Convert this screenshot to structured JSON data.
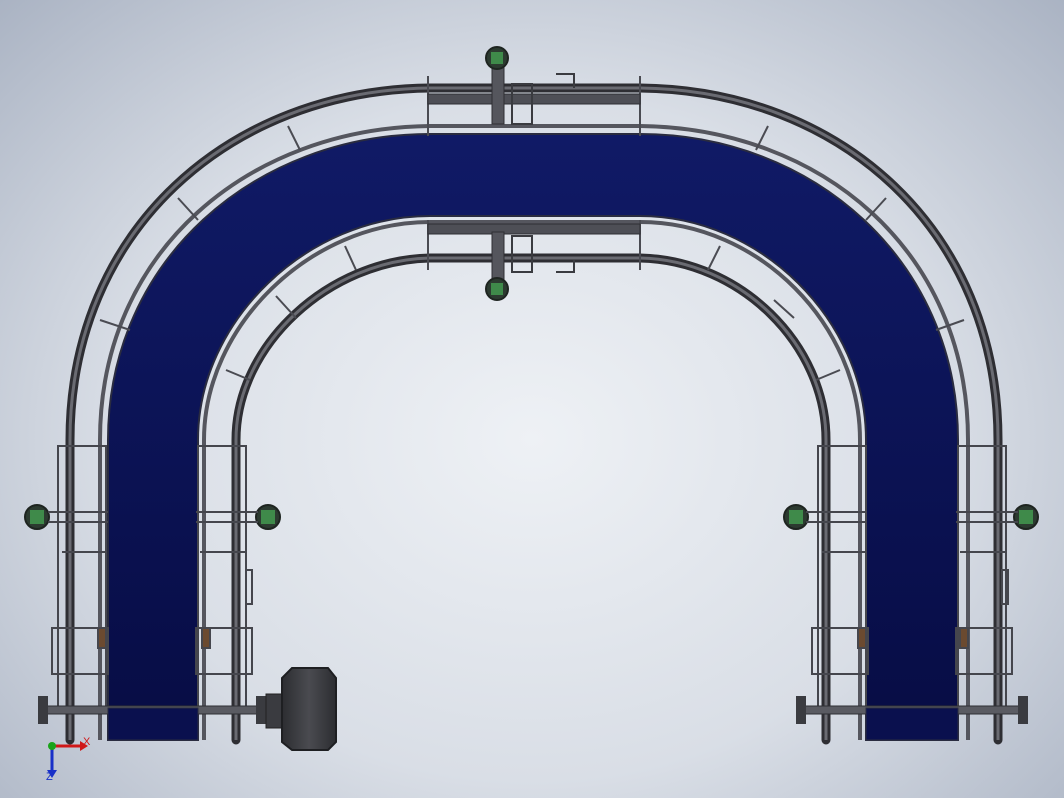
{
  "window": {
    "title": ""
  },
  "model": {
    "name": "",
    "belt_color": "#0c1250",
    "rail_color": "#3e3e44",
    "frame_color": "#5a5c64",
    "bearing_color": "#3f8a4a",
    "motor_color": "#3a3b40",
    "background_top": "#a4aec0",
    "background_center": "#eef1f5"
  },
  "triad": {
    "x_label": "X",
    "z_label": "Z",
    "x_color": "#d01818",
    "y_color": "#1aa31a",
    "z_color": "#1830c8"
  },
  "icons": [
    "coordinate-triad-icon"
  ]
}
